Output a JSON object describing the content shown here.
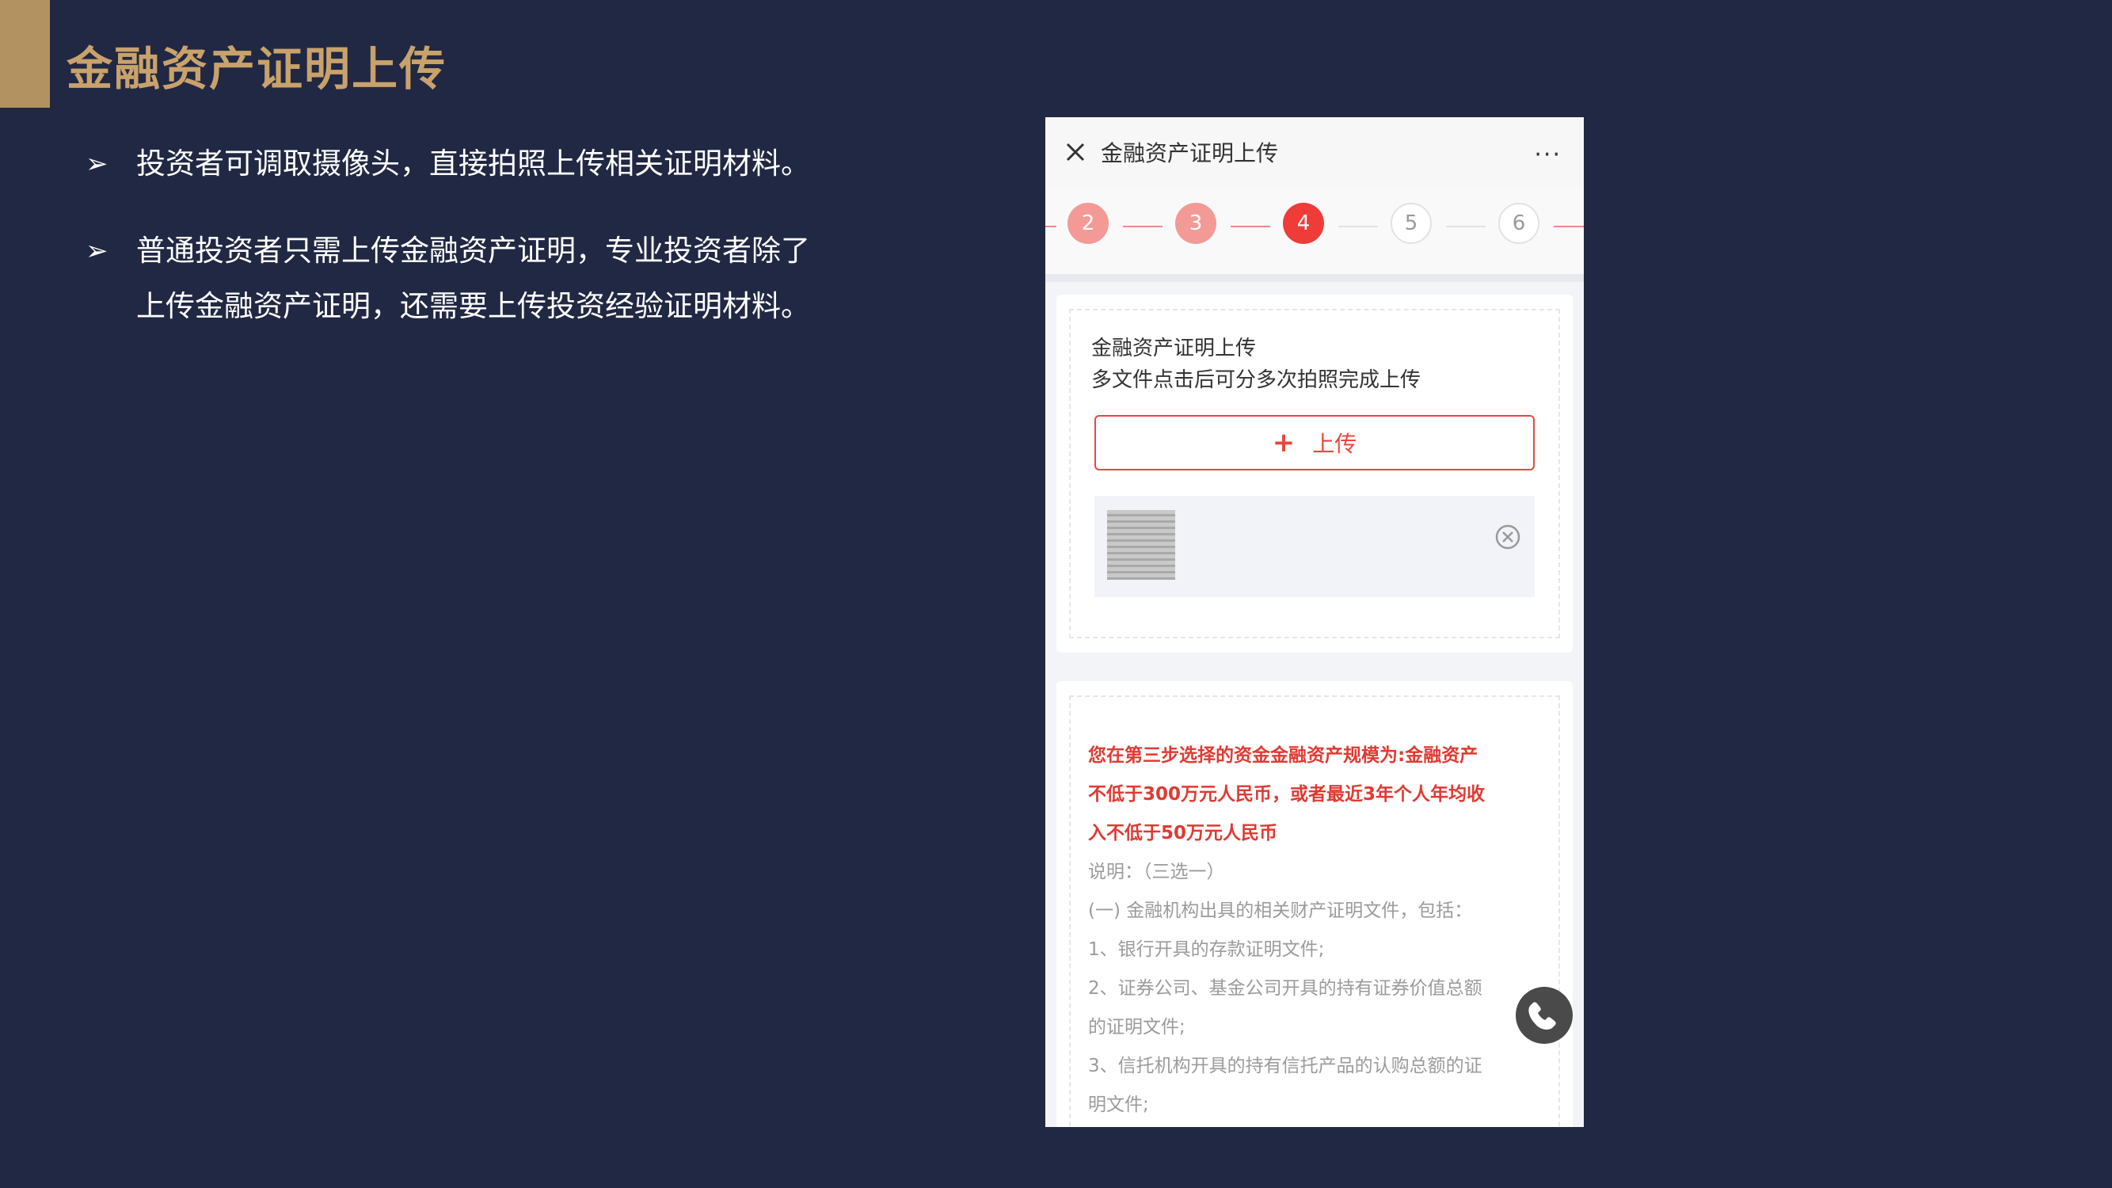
{
  "slide": {
    "title": "金融资产证明上传",
    "bullets": [
      {
        "arrow": "➢",
        "lines": [
          "投资者可调取摄像头，直接拍照上传相关证明材料。"
        ]
      },
      {
        "arrow": "➢",
        "lines": [
          "普通投资者只需上传金融资产证明，专业投资者除了",
          "上传金融资产证明，还需要上传投资经验证明材料。"
        ]
      }
    ]
  },
  "colors": {
    "background": "#212843",
    "accent_gold": "#c9a26b",
    "primary_red": "#e8473f"
  },
  "phone": {
    "header": {
      "close_icon": "close-icon",
      "title": "金融资产证明上传",
      "more_label": "···"
    },
    "steps": [
      {
        "label": "2",
        "state": "done"
      },
      {
        "label": "3",
        "state": "done"
      },
      {
        "label": "4",
        "state": "active"
      },
      {
        "label": "5",
        "state": "todo"
      },
      {
        "label": "6",
        "state": "todo"
      }
    ],
    "upload_card": {
      "title": "金融资产证明上传",
      "hint": "多文件点击后可分多次拍照完成上传",
      "button_icon": "plus-icon",
      "button_label": "上传",
      "file_remove_icon": "remove-circle-icon"
    },
    "notice_card": {
      "highlight_lines": [
        "您在第三步选择的资金金融资产规模为:金融资产",
        "不低于300万元人民币，或者最近3年个人年均收",
        "入不低于50万元人民币"
      ],
      "detail_lines": [
        "说明：（三选一）",
        "(一) 金融机构出具的相关财产证明文件，包括：",
        "1、银行开具的存款证明文件;",
        "2、证券公司、基金公司开具的持有证券价值总额",
        "的证明文件;",
        "3、信托机构开具的持有信托产品的认购总额的证",
        "明文件;"
      ]
    },
    "float_button_icon": "phone-icon"
  }
}
